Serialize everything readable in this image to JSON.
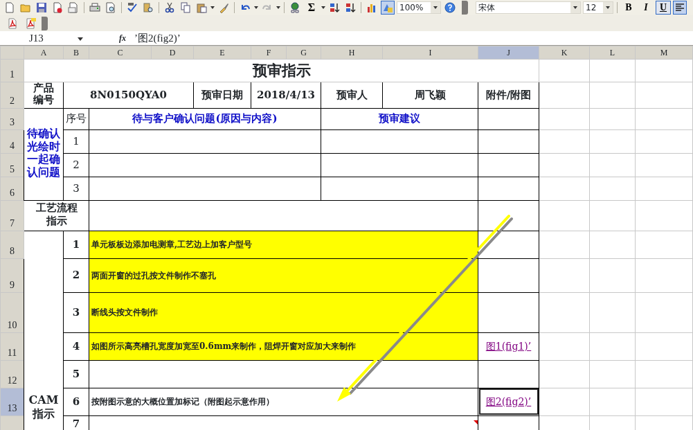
{
  "toolbar": {
    "sum_label": "Σ",
    "redo": {
      "disabled": true
    },
    "drawing_toggle": {
      "selected": true
    },
    "zoom": "100%",
    "font": "宋体",
    "font_size": "12",
    "format_buttons": [
      {
        "label": "B",
        "selected": false
      },
      {
        "label": "I",
        "selected": false
      },
      {
        "label": "U",
        "selected": true
      }
    ]
  },
  "formula_bar": {
    "name_box": "J13",
    "fx_label": "fx",
    "formula": "’图2(fig2)’"
  },
  "sheet": {
    "columns": [
      {
        "label": "A",
        "selected": false
      },
      {
        "label": "B",
        "selected": false
      },
      {
        "label": "C",
        "selected": false
      },
      {
        "label": "D",
        "selected": false
      },
      {
        "label": "E",
        "selected": false
      },
      {
        "label": "F",
        "selected": false
      },
      {
        "label": "G",
        "selected": false
      },
      {
        "label": "H",
        "selected": false
      },
      {
        "label": "I",
        "selected": false
      },
      {
        "label": "J",
        "selected": true
      },
      {
        "label": "K",
        "selected": false
      },
      {
        "label": "L",
        "selected": false
      },
      {
        "label": "M",
        "selected": false
      }
    ],
    "row_numbers": [
      {
        "label": "1",
        "selected": false
      },
      {
        "label": "2",
        "selected": false
      },
      {
        "label": "3",
        "selected": false
      },
      {
        "label": "4",
        "selected": false
      },
      {
        "label": "5",
        "selected": false
      },
      {
        "label": "6",
        "selected": false
      },
      {
        "label": "7",
        "selected": false
      },
      {
        "label": "8",
        "selected": false
      },
      {
        "label": "9",
        "selected": false
      },
      {
        "label": "10",
        "selected": false
      },
      {
        "label": "11",
        "selected": false
      },
      {
        "label": "12",
        "selected": false
      },
      {
        "label": "13",
        "selected": true
      }
    ],
    "title": "预审指示",
    "product": {
      "label": "产品编号",
      "value": "8N0150QYA0",
      "date_label": "预审日期",
      "date": "2018/4/13",
      "reviewer_label": "预审人",
      "reviewer": "周飞颖",
      "attachment_label": "附件/附图"
    },
    "pending": {
      "label": "待确认光绘时一起确认问题",
      "seq_label": "序号",
      "question_label": "待与客户确认问题(原因与内容)",
      "advice_label": "预审建议",
      "rows": [
        "1",
        "2",
        "3"
      ]
    },
    "process": {
      "label": "工艺流程指示"
    },
    "cam": {
      "label": "CAM 指示",
      "items": [
        {
          "no": "1",
          "text": "单元板板边添加电测章,工艺边上加客户型号",
          "highlighted": true,
          "attachment_selected": false,
          "has_comment": false
        },
        {
          "no": "2",
          "text": "两面开窗的过孔按文件制作不塞孔",
          "highlighted": true,
          "attachment_selected": false,
          "has_comment": false
        },
        {
          "no": "3",
          "text": "断线头按文件制作",
          "highlighted": true,
          "attachment_selected": false,
          "has_comment": false
        },
        {
          "no": "4",
          "text": "如图所示高亮槽孔宽度加宽至0.6mm来制作，阻焊开窗对应加大来制作",
          "highlighted": true,
          "attachment": "图1(fig1)’",
          "attachment_selected": false,
          "has_comment": false
        },
        {
          "no": "5",
          "highlighted": false,
          "attachment_selected": false,
          "has_comment": false
        },
        {
          "no": "6",
          "text": "按附图示意的大概位置加标记（附图起示意作用）",
          "highlighted": false,
          "attachment": "图2(fig2)’",
          "attachment_selected": true,
          "has_comment": false
        },
        {
          "no": "7",
          "highlighted": false,
          "attachment_selected": false,
          "has_comment": true
        }
      ]
    }
  }
}
